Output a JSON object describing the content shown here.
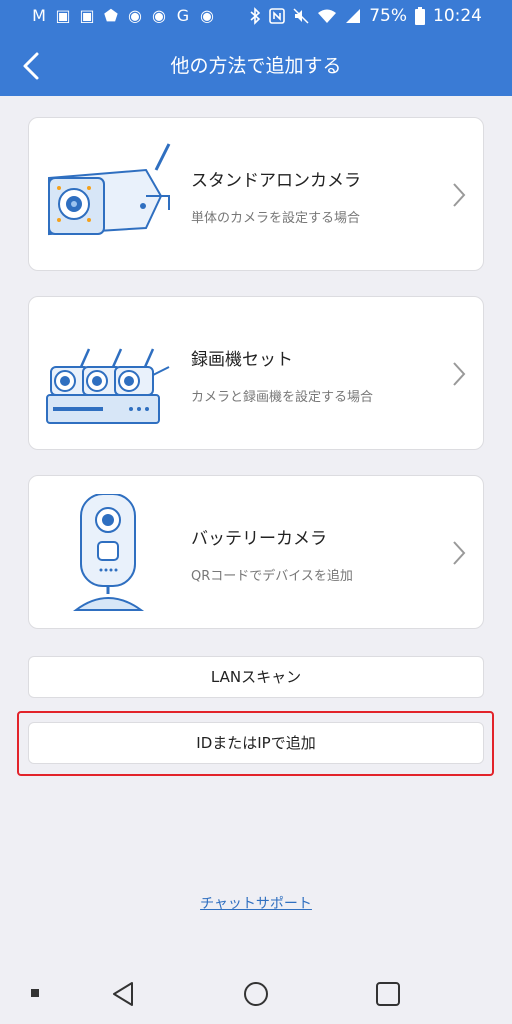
{
  "status_bar": {
    "left_icons": [
      "gmail-icon",
      "gallery-icon",
      "contacts-icon",
      "shield-icon",
      "app-icon",
      "app-icon",
      "google-icon",
      "app-icon"
    ],
    "left_glyphs": [
      "M",
      "▣",
      "▣",
      "⬟",
      "◉",
      "◉",
      "G",
      "◉"
    ],
    "battery": "75%",
    "time": "10:24"
  },
  "header": {
    "title": "他の方法で追加する",
    "color": "#3a7bd5"
  },
  "cards": [
    {
      "title": "スタンドアロンカメラ",
      "subtitle": "単体のカメラを設定する場合",
      "icon": "bullet-camera"
    },
    {
      "title": "録画機セット",
      "subtitle": "カメラと録画機を設定する場合",
      "icon": "nvr-kit"
    },
    {
      "title": "バッテリーカメラ",
      "subtitle": "QRコードでデバイスを追加",
      "icon": "battery-camera"
    }
  ],
  "buttons": {
    "lan_scan": "LANスキャン",
    "add_by_id_ip": "IDまたはIPで追加"
  },
  "support_link": "チャットサポート",
  "highlight_color": "#e2232a"
}
